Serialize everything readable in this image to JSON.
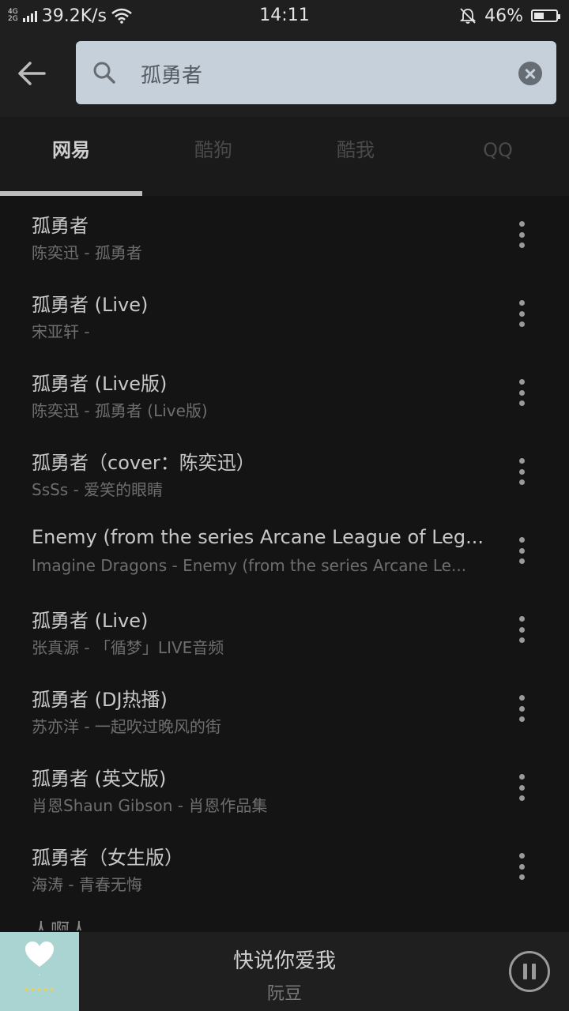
{
  "status_bar": {
    "net_top": "4G",
    "net_bottom": "2G",
    "speed": "39.2K/s",
    "time": "14:11",
    "battery": "46%",
    "battery_level": 0.46,
    "icons": [
      "signal-icon",
      "wifi-icon",
      "mute-bell-icon",
      "battery-icon"
    ]
  },
  "search": {
    "query": "孤勇者"
  },
  "tabs": [
    {
      "label": "网易",
      "active": true
    },
    {
      "label": "酷狗",
      "active": false
    },
    {
      "label": "酷我",
      "active": false
    },
    {
      "label": "QQ",
      "active": false
    }
  ],
  "results": [
    {
      "title": "孤勇者",
      "subtitle": "陈奕迅 - 孤勇者"
    },
    {
      "title": "孤勇者 (Live)",
      "subtitle": "宋亚轩 -"
    },
    {
      "title": "孤勇者 (Live版)",
      "subtitle": "陈奕迅 - 孤勇者 (Live版)"
    },
    {
      "title": "孤勇者（cover：陈奕迅）",
      "subtitle": "SsSs - 爱笑的眼睛"
    },
    {
      "title": "Enemy (from the series Arcane League of Leg...",
      "subtitle": "Imagine Dragons - Enemy (from the series Arcane Le..."
    },
    {
      "title": "孤勇者 (Live)",
      "subtitle": "张真源 - 「循梦」LIVE音频"
    },
    {
      "title": "孤勇者 (DJ热播)",
      "subtitle": "苏亦洋 - 一起吹过晚风的街"
    },
    {
      "title": "孤勇者 (英文版)",
      "subtitle": "肖恩Shaun Gibson - 肖恩作品集"
    },
    {
      "title": "孤勇者（女生版）",
      "subtitle": "海涛 - 青春无悔"
    }
  ],
  "peek_row": "人啊人",
  "player": {
    "title": "快说你爱我",
    "artist": "阮豆",
    "cover_colors": {
      "bg": "#a9d4d1",
      "stars": "#f2cf45"
    }
  }
}
